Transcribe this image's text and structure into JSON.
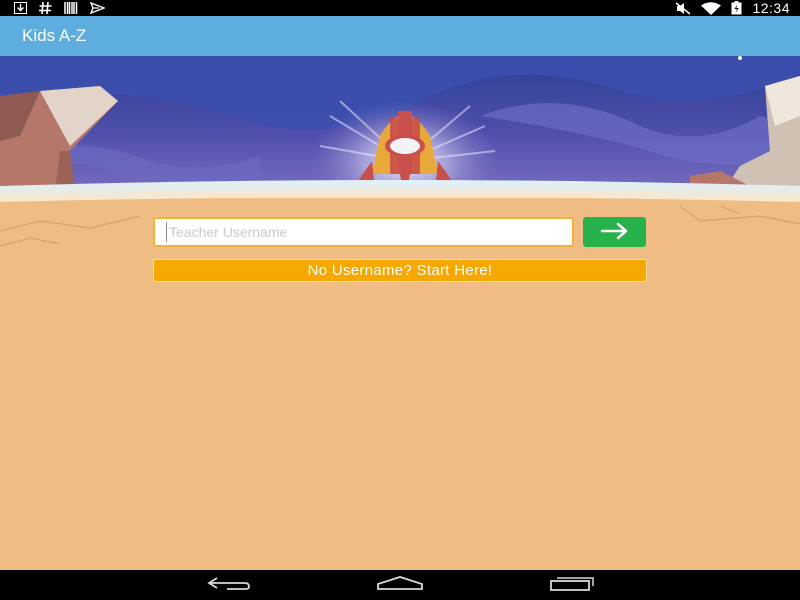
{
  "status_bar": {
    "time": "12:34",
    "left_icons": [
      "download-icon",
      "hash-icon",
      "barcode-icon",
      "send-icon"
    ],
    "right_icons": [
      "mute-icon",
      "wifi-icon",
      "battery-icon"
    ]
  },
  "app_bar": {
    "title": "Kids A-Z"
  },
  "login": {
    "username_placeholder": "Teacher Username",
    "username_value": "",
    "submit_icon": "arrow-right-icon",
    "start_label": "No Username? Start Here!"
  },
  "nav_bar": {
    "buttons": [
      "back-icon",
      "home-icon",
      "recents-icon"
    ]
  },
  "colors": {
    "app_bar": "#5eaddf",
    "ground": "#efbd83",
    "submit_button": "#27b14b",
    "start_button": "#f6a800",
    "input_border": "#f0b43a"
  }
}
